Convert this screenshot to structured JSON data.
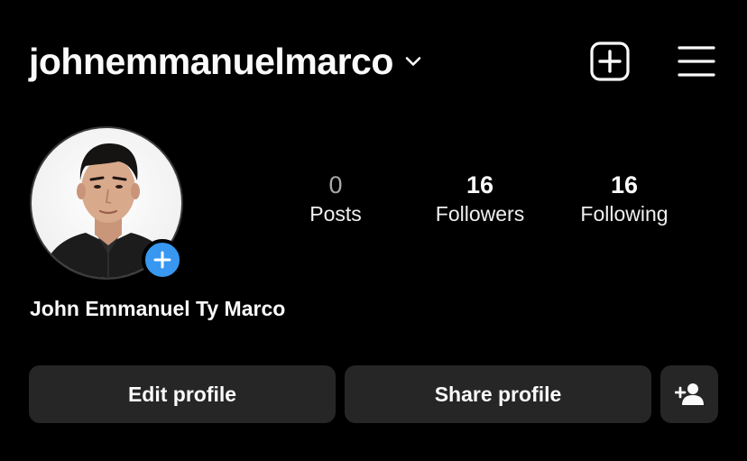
{
  "header": {
    "username": "johnemmanuelmarco",
    "icons": {
      "username_dropdown": "chevron-down-icon",
      "new_post": "plus-square-icon",
      "menu": "hamburger-menu-icon"
    }
  },
  "profile": {
    "display_name": "John Emmanuel Ty Marco",
    "avatar_icon": "profile-photo",
    "add_story_icon": "plus-icon"
  },
  "stats": {
    "posts": {
      "count": "0",
      "label": "Posts"
    },
    "followers": {
      "count": "16",
      "label": "Followers"
    },
    "following": {
      "count": "16",
      "label": "Following"
    }
  },
  "actions": {
    "edit_profile_label": "Edit profile",
    "share_profile_label": "Share profile",
    "discover_people_icon": "person-add-icon"
  },
  "colors": {
    "background": "#000000",
    "button_bg": "#262626",
    "accent_blue": "#3897f0",
    "text": "#fafafa",
    "muted_text": "#a8a8a8"
  }
}
